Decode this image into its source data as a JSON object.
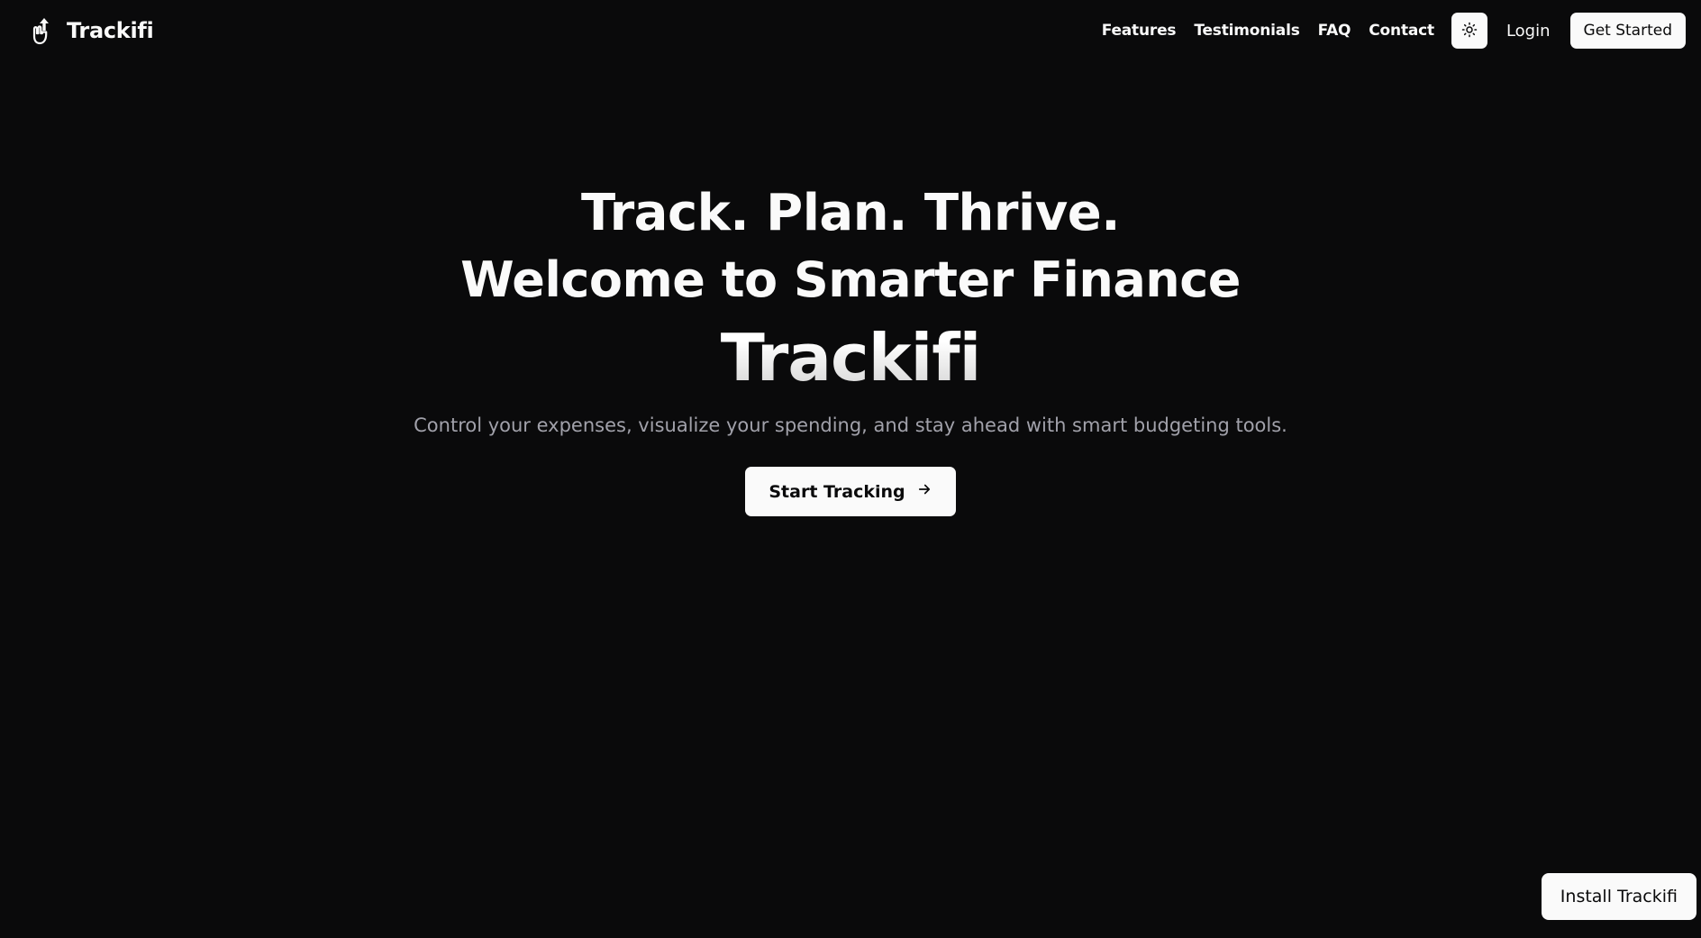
{
  "brand": {
    "name": "Trackifi",
    "logo_icon": "hand-arrow-up-icon"
  },
  "nav": {
    "links": [
      {
        "label": "Features"
      },
      {
        "label": "Testimonials"
      },
      {
        "label": "FAQ"
      },
      {
        "label": "Contact"
      }
    ],
    "theme_toggle_icon": "sun-icon",
    "login_label": "Login",
    "cta_label": "Get Started"
  },
  "hero": {
    "line1": "Track. Plan. Thrive.",
    "line2": "Welcome to Smarter Finance",
    "brand": "Trackifi",
    "subtitle": "Control your expenses, visualize your spending, and stay ahead with smart budgeting tools.",
    "button_label": "Start Tracking",
    "button_icon": "arrow-right-icon"
  },
  "install": {
    "label": "Install Trackifi"
  },
  "colors": {
    "background": "#0a0a0b",
    "foreground": "#fafafa",
    "muted": "#a1a1aa"
  }
}
